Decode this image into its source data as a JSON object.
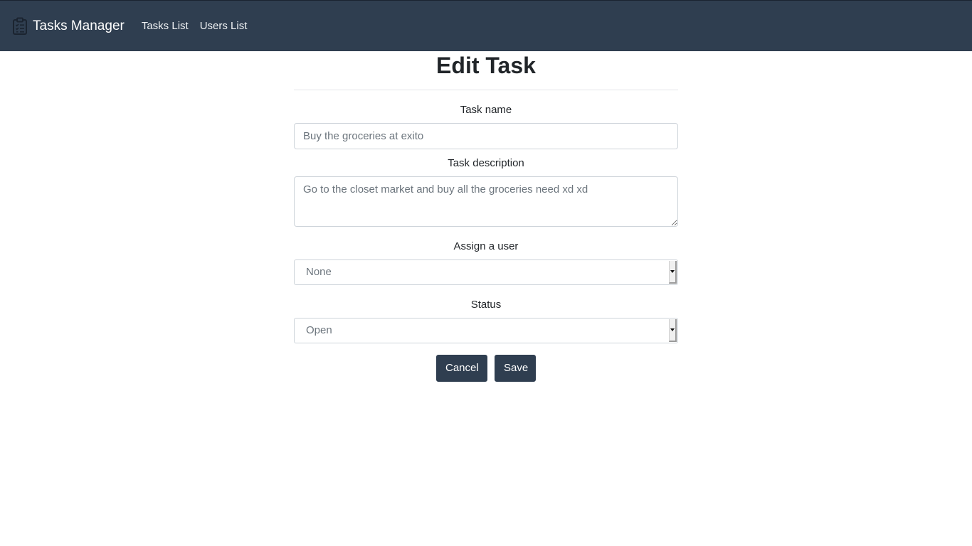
{
  "navbar": {
    "brand_icon": "clipboard-list-icon",
    "brand_text": "Tasks Manager",
    "links": [
      "Tasks List",
      "Users List"
    ]
  },
  "form": {
    "title": "Edit Task",
    "task_name": {
      "label": "Task name",
      "value": "Buy the groceries at exito"
    },
    "task_description": {
      "label": "Task description",
      "value": "Go to the closet market and buy all the groceries need xd xd"
    },
    "assign_user": {
      "label": "Assign a user",
      "selected": "None"
    },
    "status": {
      "label": "Status",
      "selected": "Open"
    },
    "cancel_label": "Cancel",
    "save_label": "Save"
  },
  "colors": {
    "navbar_bg": "#2f3e50",
    "button_bg": "#2f3e50"
  }
}
